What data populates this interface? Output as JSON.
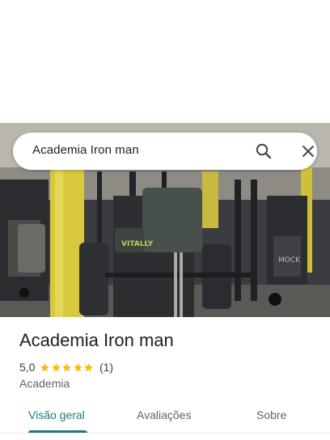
{
  "search": {
    "query": "Academia Iron man"
  },
  "place": {
    "name": "Academia Iron man",
    "rating": "5,0",
    "stars": 5,
    "review_count": "(1)",
    "category": "Academia"
  },
  "photo": {
    "brand_text": "VITALLY",
    "sign_text": "MOCK"
  },
  "tabs": [
    {
      "label": "Visão geral",
      "selected": true
    },
    {
      "label": "Avaliações",
      "selected": false
    },
    {
      "label": "Sobre",
      "selected": false
    }
  ],
  "colors": {
    "accent": "#1e7b7b",
    "star": "#fbbc04"
  },
  "icons": {
    "search": "search-icon",
    "close": "close-icon",
    "star": "star-icon"
  }
}
